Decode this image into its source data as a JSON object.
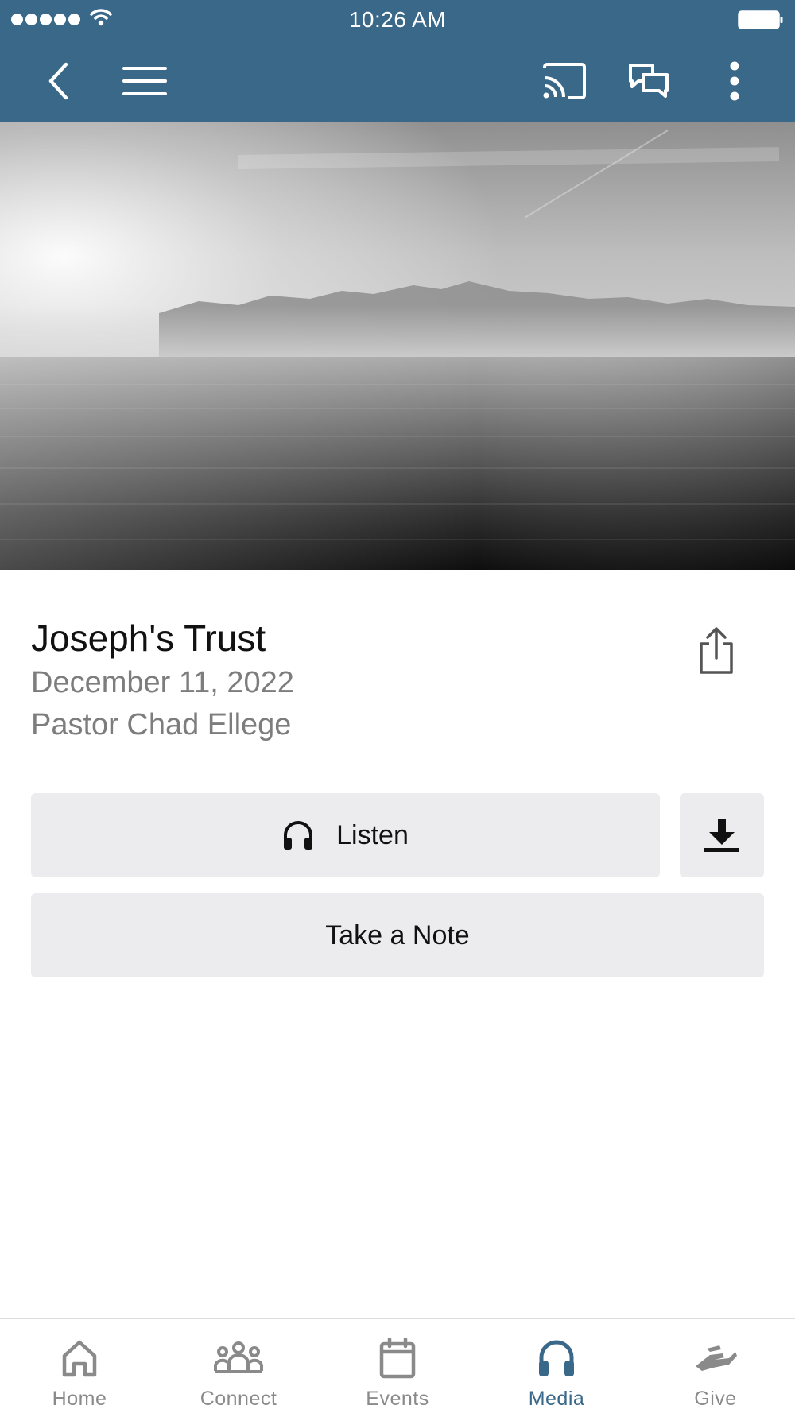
{
  "status_bar": {
    "time": "10:26 AM"
  },
  "app_bar": {
    "back_icon": "chevron-left-icon",
    "menu_icon": "hamburger-icon",
    "cast_icon": "cast-icon",
    "chat_icon": "chat-bubbles-icon",
    "more_icon": "more-vertical-icon"
  },
  "hero": {
    "image": "grayscale sea and mountains"
  },
  "sermon": {
    "title": "Joseph's Trust",
    "date": "December 11, 2022",
    "speaker": "Pastor Chad Ellege"
  },
  "actions": {
    "listen_label": "Listen",
    "note_label": "Take a Note"
  },
  "tabs": [
    {
      "label": "Home",
      "icon": "home-icon"
    },
    {
      "label": "Connect",
      "icon": "group-icon"
    },
    {
      "label": "Events",
      "icon": "calendar-icon"
    },
    {
      "label": "Media",
      "icon": "headphones-icon",
      "active": true
    },
    {
      "label": "Give",
      "icon": "giving-hand-icon"
    }
  ],
  "colors": {
    "brand": "#3a6889",
    "button_bg": "#ececee",
    "inactive_tab": "#8a8a8a"
  }
}
